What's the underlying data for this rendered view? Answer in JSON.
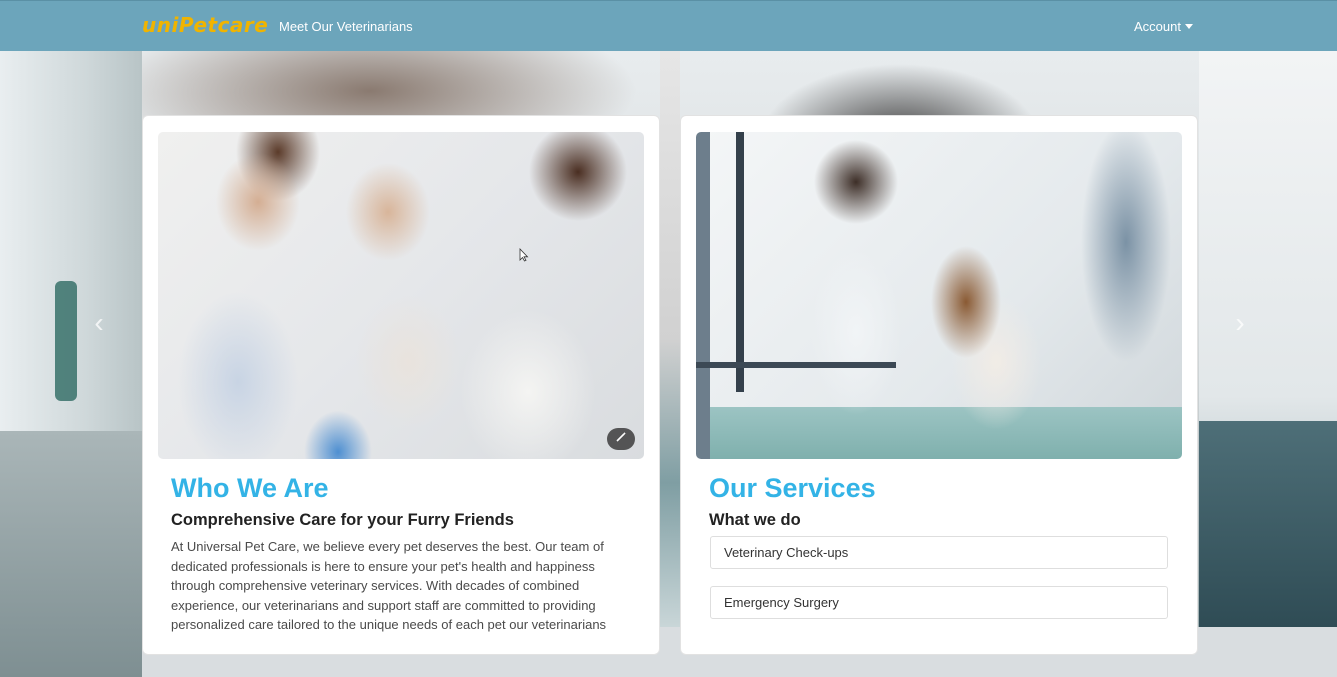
{
  "navbar": {
    "brand": "uniPetcare",
    "link": "Meet Our Veterinarians",
    "account": "Account"
  },
  "carousel": {
    "prev_glyph": "‹",
    "next_glyph": "›"
  },
  "about": {
    "title": "Who We Are",
    "subtitle": "Comprehensive Care for your Furry Friends",
    "text": "At Universal Pet Care, we believe every pet deserves the best. Our team of dedicated professionals is here to ensure your pet's health and happiness through comprehensive veterinary services. With decades of combined experience, our veterinarians and support staff are committed to providing personalized care tailored to the unique needs of each pet our veterinarians"
  },
  "services": {
    "title": "Our Services",
    "subtitle": "What we do",
    "items": [
      "Veterinary Check-ups",
      "Emergency Surgery"
    ]
  },
  "colors": {
    "navbar": "#6ca5bb",
    "brand": "#f0b400",
    "heading": "#33b3e6"
  },
  "icons": {
    "magic": "magic-wand-icon",
    "caret": "caret-down-icon"
  }
}
